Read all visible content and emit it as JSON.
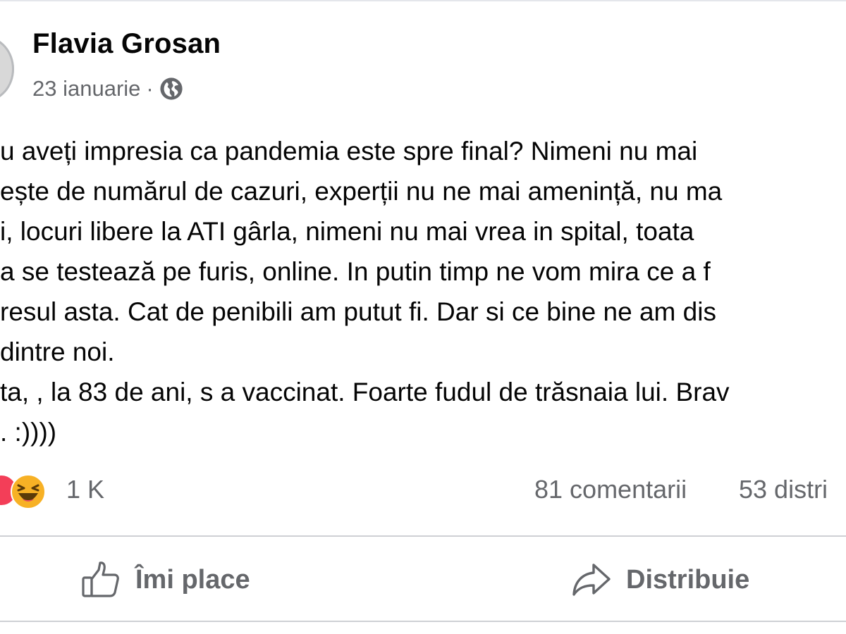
{
  "post": {
    "author": "Flavia Grosan",
    "date": "23 ianuarie",
    "separator": "·",
    "privacy_icon": "globe-icon",
    "body_lines": [
      "u aveți impresia ca pandemia este spre final? Nimeni nu mai",
      "ește de numărul de cazuri, experții nu ne mai amenință, nu ma",
      "i, locuri libere la ATI gârla, nimeni nu mai vrea in spital, toata",
      "a se testează pe furis, online. In putin timp ne vom mira ce a f",
      "resul asta. Cat de penibili am putut fi. Dar si ce bine ne am dis",
      "dintre noi.",
      "ta, , la 83 de ani, s a vaccinat. Foarte fudul de trăsnaia lui. Brav",
      ". :))))"
    ]
  },
  "stats": {
    "reactions": [
      "love-reaction-icon",
      "haha-reaction-icon"
    ],
    "reaction_count": "1 K",
    "comments": "81 comentarii",
    "shares": "53 distri"
  },
  "actions": {
    "like_label": "Îmi place",
    "like_icon": "thumbs-up-icon",
    "share_label": "Distribuie",
    "share_icon": "share-arrow-icon"
  },
  "colors": {
    "text_primary": "#050505",
    "text_secondary": "#65676b",
    "divider": "#ced0d4",
    "love": "#f33e58",
    "haha": "#f7b125"
  }
}
